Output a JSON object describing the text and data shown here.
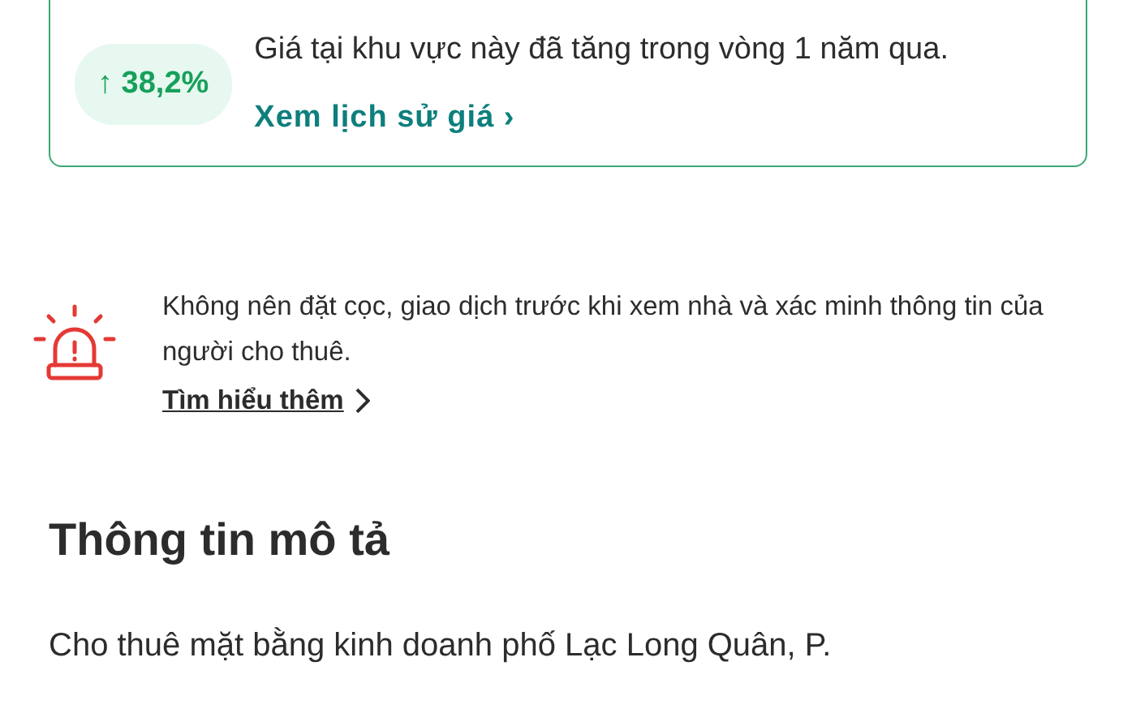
{
  "price_card": {
    "change": "↑ 38,2%",
    "text": "Giá tại khu vực này đã tăng trong vòng 1 năm qua.",
    "link": "Xem lịch sử giá",
    "link_chevron": "›"
  },
  "warning": {
    "text": "Không nên đặt cọc, giao dịch trước khi xem nhà và xác minh thông tin của người cho thuê.",
    "link": "Tìm hiểu thêm"
  },
  "description": {
    "title": "Thông tin mô tả",
    "text": "Cho thuê mặt bằng kinh doanh phố Lạc Long Quân, P."
  }
}
